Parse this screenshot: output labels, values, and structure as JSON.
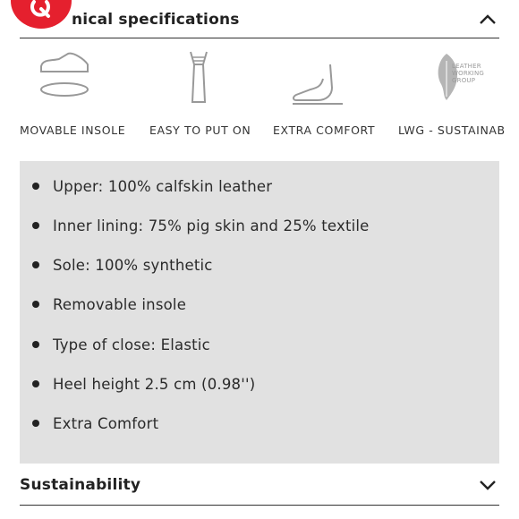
{
  "sections": {
    "technical": {
      "title": "Technical specifications",
      "visible_title": "nical specifications"
    },
    "sustainability": {
      "title": "Sustainability"
    }
  },
  "features": [
    {
      "label": "MOVABLE INSOLE",
      "icon": "insole-shoe-icon"
    },
    {
      "label": "EASY TO PUT ON",
      "icon": "elastic-strap-icon"
    },
    {
      "label": "EXTRA COMFORT",
      "icon": "foot-comfort-icon"
    },
    {
      "label": "LWG - SUSTAINAB",
      "icon": "lwg-logo-icon"
    }
  ],
  "lwg_logo_text": [
    "LEATHER",
    "WORKING",
    "GROUP"
  ],
  "specs": [
    "Upper: 100% calfskin leather",
    "Inner lining: 75% pig skin and 25% textile",
    "Sole: 100% synthetic",
    "Removable insole",
    "Type of close: Elastic",
    "Heel height 2.5 cm (0.98'')",
    "Extra Comfort"
  ],
  "colors": {
    "accent": "#e5202e",
    "panel": "#e1e1e1",
    "text": "#222222"
  }
}
